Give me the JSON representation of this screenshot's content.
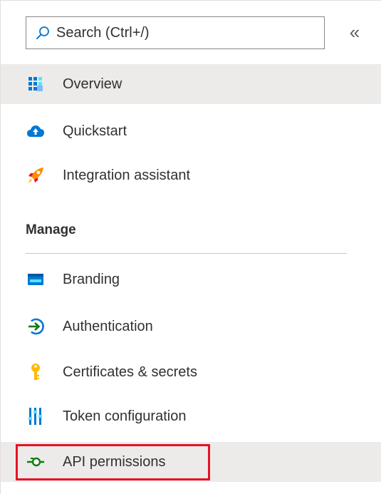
{
  "search": {
    "placeholder": "Search (Ctrl+/)",
    "value": ""
  },
  "collapse_label": "«",
  "nav": {
    "overview": "Overview",
    "quickstart": "Quickstart",
    "integration": "Integration assistant"
  },
  "manage": {
    "header": "Manage",
    "branding": "Branding",
    "authentication": "Authentication",
    "certificates": "Certificates & secrets",
    "token": "Token configuration",
    "api_permissions": "API permissions"
  },
  "colors": {
    "selected_bg": "#edebe9",
    "highlight_border": "#e81123",
    "accent_blue": "#0078d4",
    "accent_green": "#107c10"
  }
}
